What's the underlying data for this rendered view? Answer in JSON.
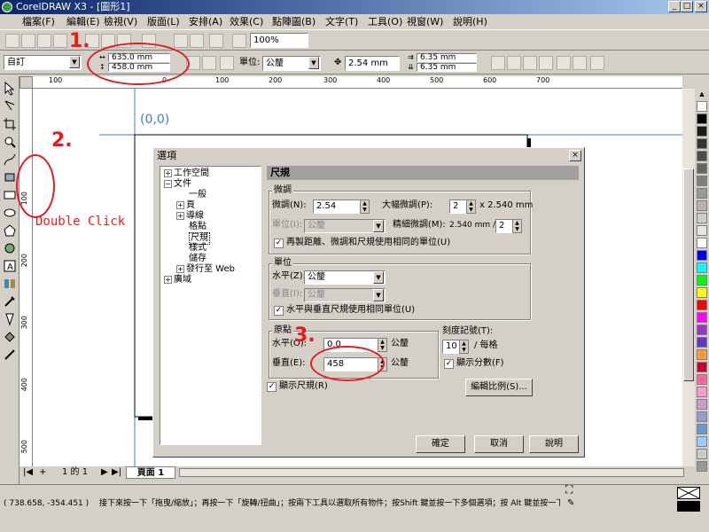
{
  "window": {
    "title": "CorelDRAW X3 - [圖形1]",
    "min_label": "_",
    "max_label": "□",
    "close_label": "×"
  },
  "menu": [
    "檔案(F)",
    "編輯(E)",
    "檢視(V)",
    "版面(L)",
    "安排(A)",
    "效果(C)",
    "點陣圖(B)",
    "文字(T)",
    "工具(O)",
    "視窗(W)",
    "說明(H)"
  ],
  "toolbar": {
    "zoom_value": "100%"
  },
  "propbar": {
    "preset": "自訂",
    "width": "635.0 mm",
    "height": "458.0 mm",
    "unit_label": "單位:",
    "unit_value": "公釐",
    "nudge": "2.54 mm",
    "dup_x": "6.35 mm",
    "dup_y": "6.35 mm"
  },
  "rulers": {
    "h_ticks": [
      "100",
      "0",
      "100",
      "200",
      "300",
      "400",
      "500",
      "600",
      "700"
    ],
    "v_ticks": [
      "100",
      "200",
      "300",
      "400",
      "500"
    ]
  },
  "canvas": {
    "origin_label": "(0,0)"
  },
  "annotations": {
    "step1": "1.",
    "step2": "2.",
    "step3": "3.",
    "double_click": "Double Click"
  },
  "dialog": {
    "title": "選項",
    "close_label": "×",
    "tree": [
      "工作空間",
      "文件",
      "一般",
      "頁",
      "導線",
      "格點",
      "尺規",
      "樣式",
      "儲存",
      "發行至 Web",
      "廣域"
    ],
    "section_title": "尺規",
    "nudge_group": "微調",
    "nudge_label": "微調(N):",
    "nudge_value": "2.54",
    "super_nudge_label": "大幅微調(P):",
    "super_nudge_value": "2",
    "super_nudge_suffix": "x 2.540 mm",
    "units_label": "單位(I):",
    "units_value": "公釐",
    "micro_label": "精細微調(M):",
    "micro_prefix": "2.540 mm /",
    "micro_value": "2",
    "nudge_check": "再製距離、微調和尺規使用相同的單位(U)",
    "unit_group": "單位",
    "horz_label": "水平(Z):",
    "horz_value": "公釐",
    "vert_label": "垂直(I):",
    "vert_value": "公釐",
    "unit_check": "水平與垂直尺規使用相同單位(U)",
    "origin_group": "原點",
    "origin_h_label": "水平(O):",
    "origin_h_value": "0.0",
    "origin_h_unit": "公釐",
    "origin_v_label": "垂直(E):",
    "origin_v_value": "458",
    "origin_v_unit": "公釐",
    "tick_group": "刻度記號(T):",
    "tick_value": "10",
    "tick_suffix": "/ 每格",
    "fraction_check": "顯示分數(F)",
    "show_rulers_check": "顯示尺規(R)",
    "scale_button": "編輯比例(S)...",
    "ok": "確定",
    "cancel": "取消",
    "help": "說明"
  },
  "pagebar": {
    "page_count": "1 的 1",
    "tab": "頁面 1"
  },
  "status": {
    "coords": "( 738.658, -354.451 )",
    "message": "接下來按一下「拖曳/縮放」；再按一下「旋轉/扭曲」；按兩下工具以選取所有物件；按Shift 鍵並按一下多個選項；按 Alt 鍵並按一下..."
  },
  "colors": {
    "annotation": "#e81a1a",
    "origin_label": "#3a7ad8",
    "title_bar": "#0a246a"
  },
  "palette": [
    "#ffffff",
    "#000000",
    "#1a1a1a",
    "#333333",
    "#4d4d4d",
    "#666666",
    "#808080",
    "#999999",
    "#b3b3b3",
    "#cccccc",
    "#e6e6e6",
    "#ffffff",
    "#0000ff",
    "#00ffff",
    "#00ff00",
    "#ffff00",
    "#ff0000",
    "#ff00ff",
    "#9933cc",
    "#6633cc",
    "#ff9933",
    "#cc0033",
    "#ff6699",
    "#ff99cc",
    "#cc99cc",
    "#9999cc",
    "#6699cc",
    "#99ccff",
    "#cccccc",
    "#999999"
  ]
}
